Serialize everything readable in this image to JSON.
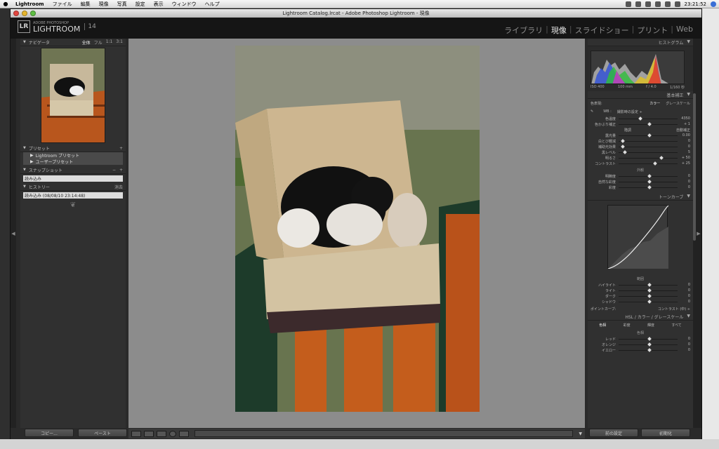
{
  "menubar": {
    "app": "Lightroom",
    "items": [
      "ファイル",
      "編集",
      "現像",
      "写真",
      "設定",
      "表示",
      "ウィンドウ",
      "ヘルプ"
    ],
    "clock": "23:21:52"
  },
  "window": {
    "title": "Lightroom Catalog.lrcat - Adobe Photoshop Lightroom - 現像"
  },
  "identity": {
    "lr": "LR",
    "adobe": "ADOBE PHOTOSHOP",
    "product": "LIGHTROOM",
    "version": "14",
    "modules": [
      "ライブラリ",
      "現像",
      "スライドショー",
      "プリント",
      "Web"
    ],
    "active_module": "現像"
  },
  "left": {
    "navigator": {
      "title": "ナビゲータ",
      "zoom": [
        "全体",
        "フル",
        "1:1",
        "3:1"
      ]
    },
    "presets": {
      "title": "プリセット",
      "items": [
        "Lightroom プリセット",
        "ユーザープリセット"
      ]
    },
    "snapshots": {
      "title": "スナップショット",
      "items": [
        "読み込み"
      ]
    },
    "history": {
      "title": "ヒストリー",
      "clear": "消去",
      "items": [
        "読み込み (08/08/10 23:14:48)"
      ]
    },
    "copy_button": "コピー...",
    "paste_button": "ペースト"
  },
  "right": {
    "histogram": {
      "title": "ヒストグラム",
      "iso": "ISO 400",
      "focal": "100 mm",
      "aperture": "f / 4.0",
      "shutter": "1/160 秒"
    },
    "basic": {
      "title": "基本補正",
      "treatment_label": "色表現:",
      "treatment_color": "カラー",
      "treatment_gray": "グレースケール",
      "wb_label": "WB :",
      "wb_value": "撮影時の設定 ÷",
      "temp": {
        "label": "色温度",
        "value": "4350"
      },
      "tint": {
        "label": "色かぶり補正",
        "value": "+ 1"
      },
      "tone_head": "階調",
      "auto": "自動補正",
      "tone": [
        {
          "label": "露光量",
          "value": "0.00"
        },
        {
          "label": "白とび軽減",
          "value": "0"
        },
        {
          "label": "補助光効果",
          "value": "0"
        },
        {
          "label": "黒レベル",
          "value": "5"
        },
        {
          "label": "明るさ",
          "value": "+ 50"
        },
        {
          "label": "コントラスト",
          "value": "+ 25"
        }
      ],
      "presence_head": "外観",
      "presence": [
        {
          "label": "明瞭度",
          "value": "0"
        },
        {
          "label": "自然な彩度",
          "value": "0"
        },
        {
          "label": "彩度",
          "value": "0"
        }
      ]
    },
    "tone_curve": {
      "title": "トーンカーブ",
      "region_head": "範囲",
      "regions": [
        {
          "label": "ハイライト",
          "value": "0"
        },
        {
          "label": "ライト",
          "value": "0"
        },
        {
          "label": "ダーク",
          "value": "0"
        },
        {
          "label": "シャドウ",
          "value": "0"
        }
      ],
      "point_curve_label": "ポイントカーブ:",
      "point_curve_value": "コントラスト (中) ÷"
    },
    "hsl": {
      "title": "HSL / カラー / グレースケール",
      "tabs": [
        "色相",
        "彩度",
        "輝度",
        "すべて"
      ],
      "head": "色相",
      "rows": [
        {
          "label": "レッド",
          "value": "0"
        },
        {
          "label": "オレンジ",
          "value": "0"
        },
        {
          "label": "イエロー",
          "value": "0"
        }
      ]
    },
    "prev_button": "前の設定",
    "reset_button": "初期化"
  }
}
